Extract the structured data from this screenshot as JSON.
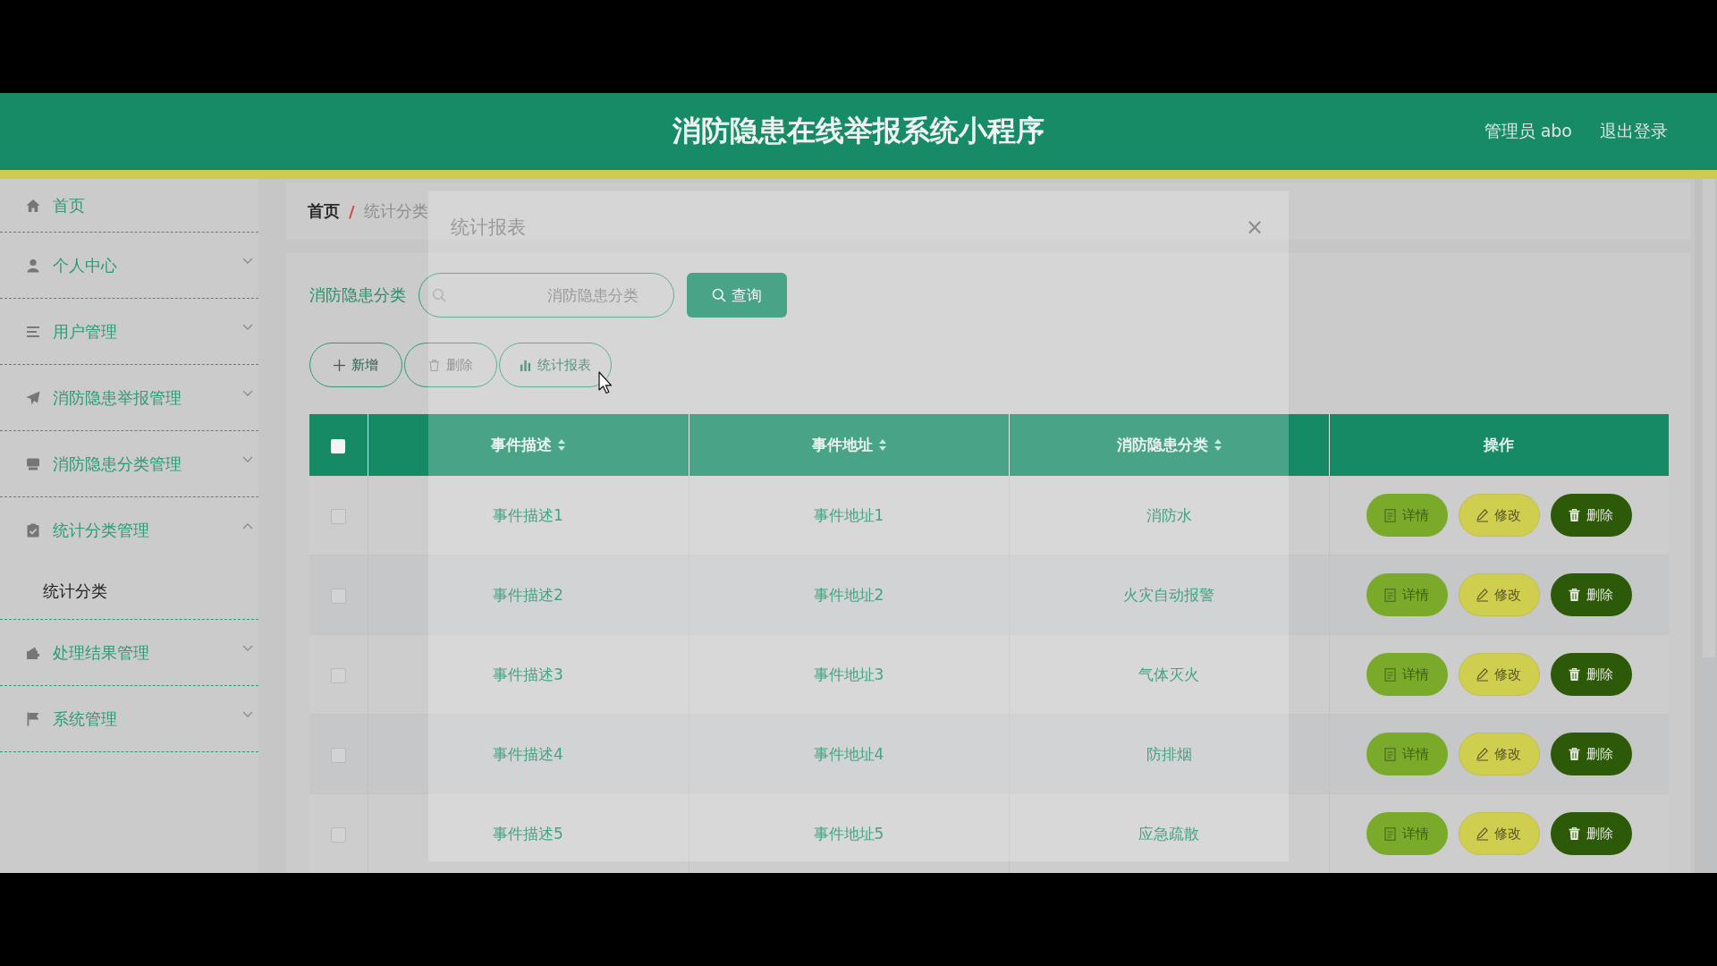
{
  "header": {
    "title": "消防隐患在线举报系统小程序",
    "user": "管理员 abo",
    "logout": "退出登录"
  },
  "sidebar": {
    "items": [
      {
        "label": "首页",
        "kind": "link"
      },
      {
        "label": "个人中心",
        "kind": "menu",
        "expanded": false
      },
      {
        "label": "用户管理",
        "kind": "menu",
        "expanded": false
      },
      {
        "label": "消防隐患举报管理",
        "kind": "menu",
        "expanded": false
      },
      {
        "label": "消防隐患分类管理",
        "kind": "menu",
        "expanded": false
      },
      {
        "label": "统计分类管理",
        "kind": "menu",
        "expanded": true,
        "children": [
          {
            "label": "统计分类",
            "selected": true
          }
        ]
      },
      {
        "label": "处理结果管理",
        "kind": "menu",
        "expanded": false
      },
      {
        "label": "系统管理",
        "kind": "menu",
        "expanded": false
      }
    ]
  },
  "breadcrumb": {
    "items": [
      "首页",
      "统计分类"
    ],
    "separator": "/"
  },
  "search": {
    "label": "消防隐患分类",
    "placeholder": "消防隐患分类",
    "button": "查询"
  },
  "toolbar": [
    {
      "kind": "add",
      "label": "新增"
    },
    {
      "kind": "delete",
      "label": "删除"
    },
    {
      "kind": "chart",
      "label": "统计报表"
    }
  ],
  "table": {
    "select_all": {
      "checked": false
    },
    "columns": [
      {
        "label": "事件描述",
        "sortable": true
      },
      {
        "label": "事件地址",
        "sortable": true
      },
      {
        "label": "消防隐患分类",
        "sortable": true
      },
      {
        "label": "操作",
        "sortable": false
      }
    ],
    "rows": [
      {
        "checked": false,
        "cells": [
          "事件描述1",
          "事件地址1",
          "消防水"
        ],
        "actions": [
          {
            "kind": "detail",
            "label": "详情"
          },
          {
            "kind": "edit",
            "label": "修改"
          },
          {
            "kind": "delete",
            "label": "删除"
          }
        ]
      },
      {
        "checked": false,
        "cells": [
          "事件描述2",
          "事件地址2",
          "火灾自动报警"
        ],
        "actions": [
          {
            "kind": "detail",
            "label": "详情"
          },
          {
            "kind": "edit",
            "label": "修改"
          },
          {
            "kind": "delete",
            "label": "删除"
          }
        ]
      },
      {
        "checked": false,
        "cells": [
          "事件描述3",
          "事件地址3",
          "气体灭火"
        ],
        "actions": [
          {
            "kind": "detail",
            "label": "详情"
          },
          {
            "kind": "edit",
            "label": "修改"
          },
          {
            "kind": "delete",
            "label": "删除"
          }
        ]
      },
      {
        "checked": false,
        "cells": [
          "事件描述4",
          "事件地址4",
          "防排烟"
        ],
        "actions": [
          {
            "kind": "detail",
            "label": "详情"
          },
          {
            "kind": "edit",
            "label": "修改"
          },
          {
            "kind": "delete",
            "label": "删除"
          }
        ]
      },
      {
        "checked": false,
        "cells": [
          "事件描述5",
          "事件地址5",
          "应急疏散"
        ],
        "actions": [
          {
            "kind": "detail",
            "label": "详情"
          },
          {
            "kind": "edit",
            "label": "修改"
          },
          {
            "kind": "delete",
            "label": "删除"
          }
        ]
      }
    ]
  },
  "dialog": {
    "title": "统计报表",
    "close": "×"
  }
}
